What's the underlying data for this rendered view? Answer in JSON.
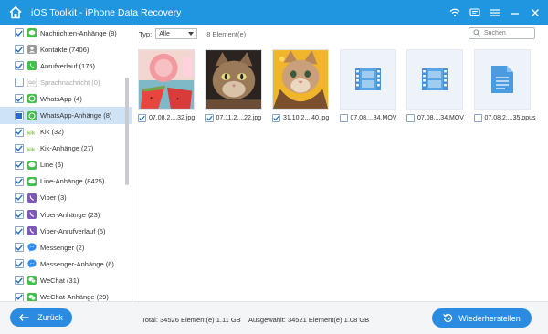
{
  "window": {
    "title": "iOS Toolkit - iPhone Data Recovery"
  },
  "titlebar_icons": [
    "wifi-icon",
    "chat-icon",
    "menu-icon",
    "minimize-icon",
    "close-icon"
  ],
  "sidebar": {
    "items": [
      {
        "label": "Nachrichten-Anhänge (8)",
        "checked": true,
        "icon": "message-icon",
        "color": "#3fc14a"
      },
      {
        "label": "Kontakte (7406)",
        "checked": true,
        "icon": "contacts-icon",
        "color": "#9a9a9a"
      },
      {
        "label": "Anrufverlauf (175)",
        "checked": true,
        "icon": "phone-icon",
        "color": "#3fc14a"
      },
      {
        "label": "Sprachnachricht (0)",
        "checked": false,
        "dim": true,
        "icon": "voicemail-icon",
        "color": "#c0c0c0"
      },
      {
        "label": "WhatsApp (4)",
        "checked": true,
        "icon": "whatsapp-icon",
        "color": "#3fc14a"
      },
      {
        "label": "WhatsApp-Anhänge (8)",
        "checked": true,
        "selected": true,
        "icon": "whatsapp-icon",
        "color": "#3fc14a"
      },
      {
        "label": "Kik (32)",
        "checked": true,
        "icon": "kik-icon",
        "color": "#82c341"
      },
      {
        "label": "Kik-Anhänge (27)",
        "checked": true,
        "icon": "kik-icon",
        "color": "#82c341"
      },
      {
        "label": "Line (6)",
        "checked": true,
        "icon": "line-icon",
        "color": "#3fc14a"
      },
      {
        "label": "Line-Anhänge (8425)",
        "checked": true,
        "icon": "line-icon",
        "color": "#3fc14a"
      },
      {
        "label": "Viber (3)",
        "checked": true,
        "icon": "viber-icon",
        "color": "#7d58b8"
      },
      {
        "label": "Viber-Anhänge (23)",
        "checked": true,
        "icon": "viber-icon",
        "color": "#7d58b8"
      },
      {
        "label": "Viber-Anrufverlauf (5)",
        "checked": true,
        "icon": "viber-icon",
        "color": "#7d58b8"
      },
      {
        "label": "Messenger (2)",
        "checked": true,
        "icon": "messenger-icon",
        "color": "#2f8df0"
      },
      {
        "label": "Messenger-Anhänge (6)",
        "checked": true,
        "icon": "messenger-icon",
        "color": "#2f8df0"
      },
      {
        "label": "WeChat (31)",
        "checked": true,
        "icon": "wechat-icon",
        "color": "#3fc14a"
      },
      {
        "label": "WeChat-Anhänge (29)",
        "checked": true,
        "icon": "wechat-icon",
        "color": "#3fc14a"
      }
    ]
  },
  "filter": {
    "type_label": "Typ:",
    "type_value": "Alle",
    "count_label": "8 Element(e)",
    "search_placeholder": "Suchen"
  },
  "files": [
    {
      "name": "07.08.2....32.jpg",
      "kind": "photo-food",
      "checked": true
    },
    {
      "name": "07.11.2....22.jpg",
      "kind": "photo-cat",
      "checked": true
    },
    {
      "name": "31.10.2....40.jpg",
      "kind": "photo-cat-yellow",
      "checked": true
    },
    {
      "name": "07.08....34.MOV",
      "kind": "video",
      "checked": false
    },
    {
      "name": "07.08....34.MOV",
      "kind": "video",
      "checked": false
    },
    {
      "name": "07.08.2....35.opus",
      "kind": "document",
      "checked": false
    }
  ],
  "footer": {
    "back_label": "Zurück",
    "total": "Total: 34526 Element(e) 1.11 GB",
    "selected": "Ausgewählt: 34521 Element(e) 1.08 GB",
    "restore_label": "Wiederherstellen"
  },
  "colors": {
    "titlebar": "#2196e0",
    "accent": "#2a8be0",
    "selected_row": "#cfe3f6",
    "checkbox_border": "#8aa6c6"
  }
}
